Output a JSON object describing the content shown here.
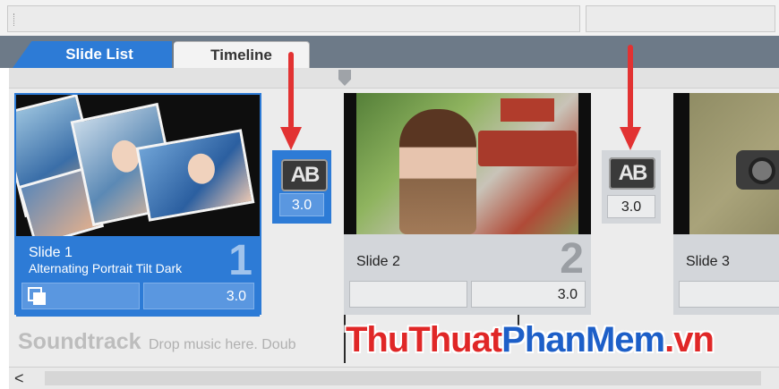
{
  "tabs": [
    {
      "label": "Slide List",
      "active": true
    },
    {
      "label": "Timeline",
      "active": false
    }
  ],
  "slides": [
    {
      "title": "Slide 1",
      "subtitle": "Alternating Portrait Tilt Dark",
      "number": "1",
      "duration": "3.0",
      "selected": true
    },
    {
      "title": "Slide 2",
      "subtitle": "",
      "number": "2",
      "duration": "3.0",
      "selected": false
    },
    {
      "title": "Slide 3",
      "subtitle": "",
      "number": "",
      "duration": "",
      "selected": false
    }
  ],
  "transitions": [
    {
      "icon_label": "AB",
      "duration": "3.0",
      "selected": true
    },
    {
      "icon_label": "AB",
      "duration": "3.0",
      "selected": false
    }
  ],
  "soundtrack": {
    "title": "Soundtrack",
    "hint": "Drop music here.  Doub"
  },
  "watermark": {
    "part1": "ThuThuat",
    "part2": "PhanMem",
    "part3": ".vn"
  },
  "scrollbar": {
    "left_arrow": "<"
  },
  "colors": {
    "accent_blue": "#2d7bd6",
    "arrow_red": "#e23232",
    "tab_bar": "#6d7a88"
  }
}
